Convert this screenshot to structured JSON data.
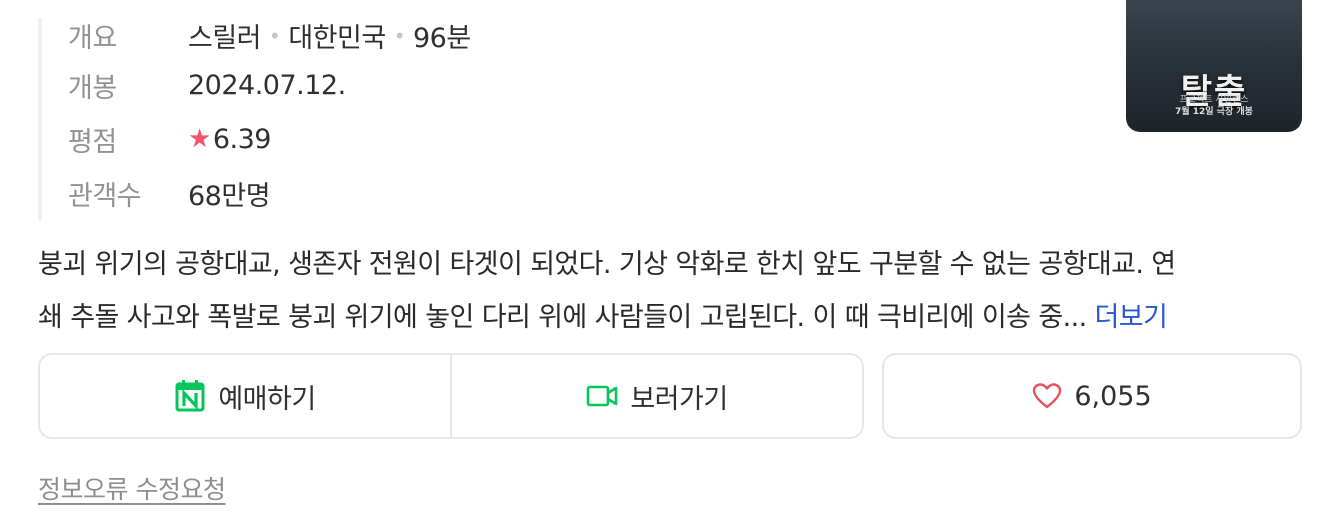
{
  "info": {
    "rows": [
      {
        "label": "개요",
        "genre": "스릴러",
        "country": "대한민국",
        "runtime": "96분"
      },
      {
        "label": "개봉",
        "value": "2024.07.12."
      },
      {
        "label": "평점",
        "star": "★",
        "value": "6.39"
      },
      {
        "label": "관객수",
        "value": "68만명"
      }
    ]
  },
  "poster": {
    "title": "탈출",
    "subtitle": "프로젝트 사일런스",
    "release_note": "7월 12일 극장 개봉"
  },
  "synopsis": {
    "line1": "붕괴 위기의 공항대교, 생존자 전원이 타겟이 되었다. 기상 악화로 한치 앞도 구분할 수 없는 공항대교. 연",
    "line2": "쇄 추돌 사고와 폭발로 붕괴 위기에 놓인 다리 위에 사람들이 고립된다. 이 때 극비리에 이송 중...",
    "more": "더보기"
  },
  "actions": {
    "reserve_label": "예매하기",
    "watch_label": "보러가기",
    "like_count": "6,055"
  },
  "report_link": "정보오류 수정요청",
  "colors": {
    "accent_green": "#03c75a",
    "like_red": "#e8515f",
    "link_blue": "#2758d6",
    "star_red": "#f0566c"
  }
}
